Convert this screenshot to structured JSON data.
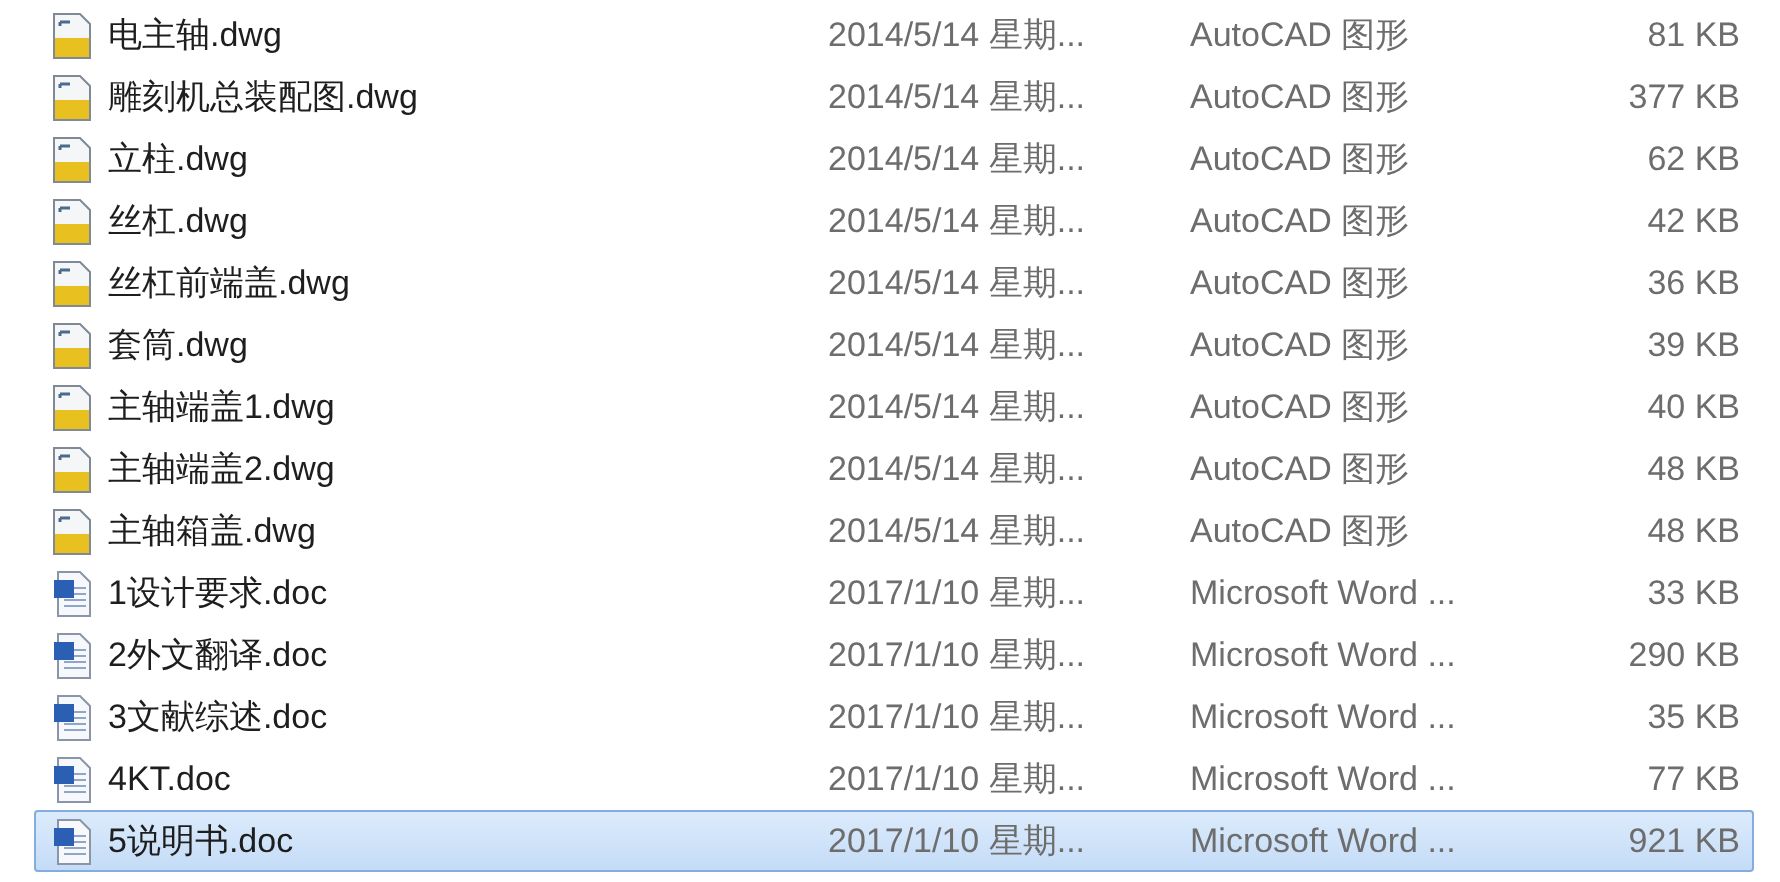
{
  "files": [
    {
      "name": "电主轴.dwg",
      "date": "2014/5/14 星期...",
      "type": "AutoCAD 图形",
      "size": "81 KB",
      "kind": "dwg",
      "selected": false
    },
    {
      "name": "雕刻机总装配图.dwg",
      "date": "2014/5/14 星期...",
      "type": "AutoCAD 图形",
      "size": "377 KB",
      "kind": "dwg",
      "selected": false
    },
    {
      "name": "立柱.dwg",
      "date": "2014/5/14 星期...",
      "type": "AutoCAD 图形",
      "size": "62 KB",
      "kind": "dwg",
      "selected": false
    },
    {
      "name": "丝杠.dwg",
      "date": "2014/5/14 星期...",
      "type": "AutoCAD 图形",
      "size": "42 KB",
      "kind": "dwg",
      "selected": false
    },
    {
      "name": "丝杠前端盖.dwg",
      "date": "2014/5/14 星期...",
      "type": "AutoCAD 图形",
      "size": "36 KB",
      "kind": "dwg",
      "selected": false
    },
    {
      "name": "套筒.dwg",
      "date": "2014/5/14 星期...",
      "type": "AutoCAD 图形",
      "size": "39 KB",
      "kind": "dwg",
      "selected": false
    },
    {
      "name": "主轴端盖1.dwg",
      "date": "2014/5/14 星期...",
      "type": "AutoCAD 图形",
      "size": "40 KB",
      "kind": "dwg",
      "selected": false
    },
    {
      "name": "主轴端盖2.dwg",
      "date": "2014/5/14 星期...",
      "type": "AutoCAD 图形",
      "size": "48 KB",
      "kind": "dwg",
      "selected": false
    },
    {
      "name": "主轴箱盖.dwg",
      "date": "2014/5/14 星期...",
      "type": "AutoCAD 图形",
      "size": "48 KB",
      "kind": "dwg",
      "selected": false
    },
    {
      "name": "1设计要求.doc",
      "date": "2017/1/10 星期...",
      "type": "Microsoft Word ...",
      "size": "33 KB",
      "kind": "doc",
      "selected": false
    },
    {
      "name": "2外文翻译.doc",
      "date": "2017/1/10 星期...",
      "type": "Microsoft Word ...",
      "size": "290 KB",
      "kind": "doc",
      "selected": false
    },
    {
      "name": "3文献综述.doc",
      "date": "2017/1/10 星期...",
      "type": "Microsoft Word ...",
      "size": "35 KB",
      "kind": "doc",
      "selected": false
    },
    {
      "name": "4KT.doc",
      "date": "2017/1/10 星期...",
      "type": "Microsoft Word ...",
      "size": "77 KB",
      "kind": "doc",
      "selected": false
    },
    {
      "name": "5说明书.doc",
      "date": "2017/1/10 星期...",
      "type": "Microsoft Word ...",
      "size": "921 KB",
      "kind": "doc",
      "selected": true
    }
  ]
}
